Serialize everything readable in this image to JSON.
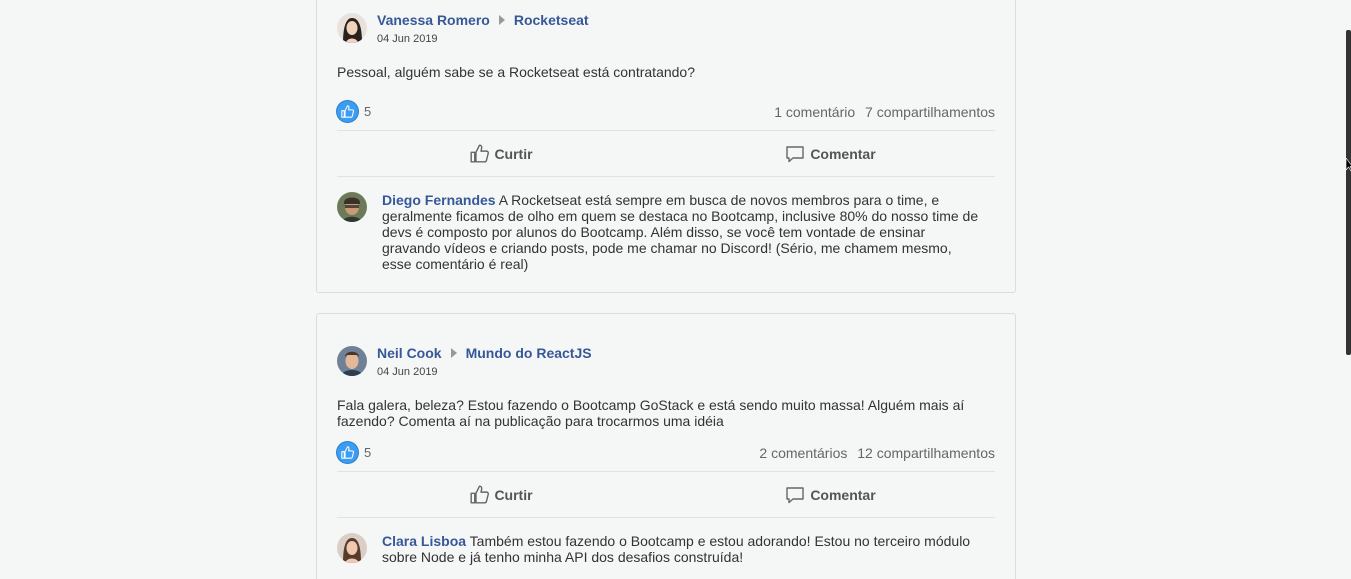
{
  "posts": [
    {
      "author": "Vanessa Romero",
      "group": "Rocketseat",
      "date": "04 Jun 2019",
      "content": "Pessoal, alguém sabe se a Rocketseat está contratando?",
      "likes": "5",
      "comments_count": "1 comentário",
      "shares_count": "7 compartilhamentos",
      "like_label": "Curtir",
      "comment_label": "Comentar",
      "comments": [
        {
          "author": "Diego Fernandes",
          "text": "A Rocketseat está sempre em busca de novos membros para o time, e geralmente ficamos de olho em quem se destaca no Bootcamp, inclusive 80% do nosso time de devs é composto por alunos do Bootcamp. Além disso, se você tem vontade de ensinar gravando vídeos e criando posts, pode me chamar no Discord! (Sério, me chamem mesmo, esse comentário é real)"
        }
      ]
    },
    {
      "author": "Neil Cook",
      "group": "Mundo do ReactJS",
      "date": "04 Jun 2019",
      "content": "Fala galera, beleza? Estou fazendo o Bootcamp GoStack e está sendo muito massa! Alguém mais aí fazendo? Comenta aí na publicação para trocarmos uma idéia",
      "likes": "5",
      "comments_count": "2 comentários",
      "shares_count": "12 compartilhamentos",
      "like_label": "Curtir",
      "comment_label": "Comentar",
      "comments": [
        {
          "author": "Clara Lisboa",
          "text": "Também estou fazendo o Bootcamp e estou adorando! Estou no terceiro módulo sobre Node e já tenho minha API dos desafios construída!"
        }
      ]
    }
  ],
  "colors": {
    "link": "#365899",
    "like_badge": "#3b9cf0",
    "background": "#f5f6f6"
  }
}
